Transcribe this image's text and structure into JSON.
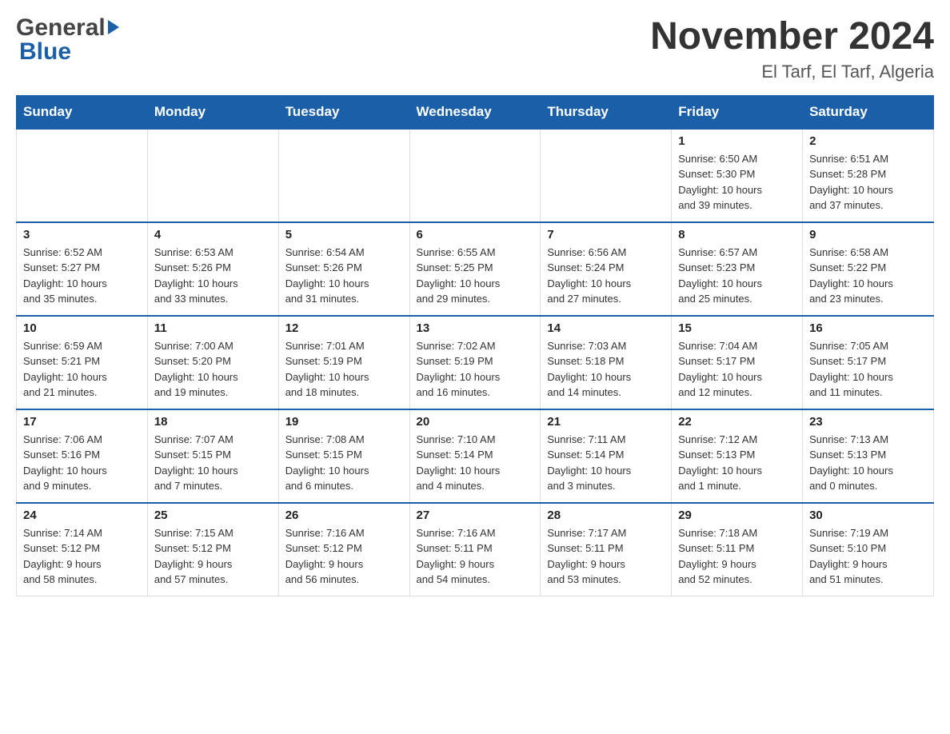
{
  "header": {
    "logo_general": "General",
    "logo_blue": "Blue",
    "title": "November 2024",
    "subtitle": "El Tarf, El Tarf, Algeria"
  },
  "days_of_week": [
    "Sunday",
    "Monday",
    "Tuesday",
    "Wednesday",
    "Thursday",
    "Friday",
    "Saturday"
  ],
  "weeks": [
    [
      {
        "day": "",
        "info": ""
      },
      {
        "day": "",
        "info": ""
      },
      {
        "day": "",
        "info": ""
      },
      {
        "day": "",
        "info": ""
      },
      {
        "day": "",
        "info": ""
      },
      {
        "day": "1",
        "info": "Sunrise: 6:50 AM\nSunset: 5:30 PM\nDaylight: 10 hours\nand 39 minutes."
      },
      {
        "day": "2",
        "info": "Sunrise: 6:51 AM\nSunset: 5:28 PM\nDaylight: 10 hours\nand 37 minutes."
      }
    ],
    [
      {
        "day": "3",
        "info": "Sunrise: 6:52 AM\nSunset: 5:27 PM\nDaylight: 10 hours\nand 35 minutes."
      },
      {
        "day": "4",
        "info": "Sunrise: 6:53 AM\nSunset: 5:26 PM\nDaylight: 10 hours\nand 33 minutes."
      },
      {
        "day": "5",
        "info": "Sunrise: 6:54 AM\nSunset: 5:26 PM\nDaylight: 10 hours\nand 31 minutes."
      },
      {
        "day": "6",
        "info": "Sunrise: 6:55 AM\nSunset: 5:25 PM\nDaylight: 10 hours\nand 29 minutes."
      },
      {
        "day": "7",
        "info": "Sunrise: 6:56 AM\nSunset: 5:24 PM\nDaylight: 10 hours\nand 27 minutes."
      },
      {
        "day": "8",
        "info": "Sunrise: 6:57 AM\nSunset: 5:23 PM\nDaylight: 10 hours\nand 25 minutes."
      },
      {
        "day": "9",
        "info": "Sunrise: 6:58 AM\nSunset: 5:22 PM\nDaylight: 10 hours\nand 23 minutes."
      }
    ],
    [
      {
        "day": "10",
        "info": "Sunrise: 6:59 AM\nSunset: 5:21 PM\nDaylight: 10 hours\nand 21 minutes."
      },
      {
        "day": "11",
        "info": "Sunrise: 7:00 AM\nSunset: 5:20 PM\nDaylight: 10 hours\nand 19 minutes."
      },
      {
        "day": "12",
        "info": "Sunrise: 7:01 AM\nSunset: 5:19 PM\nDaylight: 10 hours\nand 18 minutes."
      },
      {
        "day": "13",
        "info": "Sunrise: 7:02 AM\nSunset: 5:19 PM\nDaylight: 10 hours\nand 16 minutes."
      },
      {
        "day": "14",
        "info": "Sunrise: 7:03 AM\nSunset: 5:18 PM\nDaylight: 10 hours\nand 14 minutes."
      },
      {
        "day": "15",
        "info": "Sunrise: 7:04 AM\nSunset: 5:17 PM\nDaylight: 10 hours\nand 12 minutes."
      },
      {
        "day": "16",
        "info": "Sunrise: 7:05 AM\nSunset: 5:17 PM\nDaylight: 10 hours\nand 11 minutes."
      }
    ],
    [
      {
        "day": "17",
        "info": "Sunrise: 7:06 AM\nSunset: 5:16 PM\nDaylight: 10 hours\nand 9 minutes."
      },
      {
        "day": "18",
        "info": "Sunrise: 7:07 AM\nSunset: 5:15 PM\nDaylight: 10 hours\nand 7 minutes."
      },
      {
        "day": "19",
        "info": "Sunrise: 7:08 AM\nSunset: 5:15 PM\nDaylight: 10 hours\nand 6 minutes."
      },
      {
        "day": "20",
        "info": "Sunrise: 7:10 AM\nSunset: 5:14 PM\nDaylight: 10 hours\nand 4 minutes."
      },
      {
        "day": "21",
        "info": "Sunrise: 7:11 AM\nSunset: 5:14 PM\nDaylight: 10 hours\nand 3 minutes."
      },
      {
        "day": "22",
        "info": "Sunrise: 7:12 AM\nSunset: 5:13 PM\nDaylight: 10 hours\nand 1 minute."
      },
      {
        "day": "23",
        "info": "Sunrise: 7:13 AM\nSunset: 5:13 PM\nDaylight: 10 hours\nand 0 minutes."
      }
    ],
    [
      {
        "day": "24",
        "info": "Sunrise: 7:14 AM\nSunset: 5:12 PM\nDaylight: 9 hours\nand 58 minutes."
      },
      {
        "day": "25",
        "info": "Sunrise: 7:15 AM\nSunset: 5:12 PM\nDaylight: 9 hours\nand 57 minutes."
      },
      {
        "day": "26",
        "info": "Sunrise: 7:16 AM\nSunset: 5:12 PM\nDaylight: 9 hours\nand 56 minutes."
      },
      {
        "day": "27",
        "info": "Sunrise: 7:16 AM\nSunset: 5:11 PM\nDaylight: 9 hours\nand 54 minutes."
      },
      {
        "day": "28",
        "info": "Sunrise: 7:17 AM\nSunset: 5:11 PM\nDaylight: 9 hours\nand 53 minutes."
      },
      {
        "day": "29",
        "info": "Sunrise: 7:18 AM\nSunset: 5:11 PM\nDaylight: 9 hours\nand 52 minutes."
      },
      {
        "day": "30",
        "info": "Sunrise: 7:19 AM\nSunset: 5:10 PM\nDaylight: 9 hours\nand 51 minutes."
      }
    ]
  ]
}
